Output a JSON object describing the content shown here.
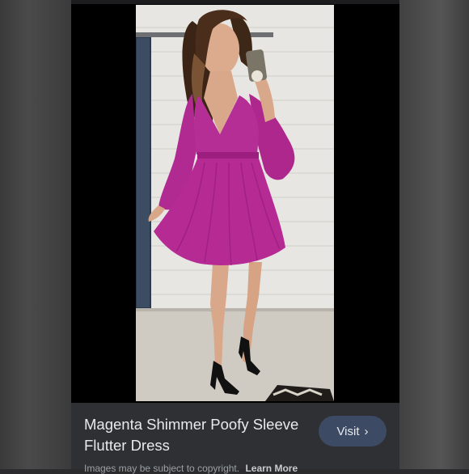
{
  "result": {
    "title": "Magenta Shimmer Poofy Sleeve Flutter Dress",
    "visit_label": "Visit",
    "copyright_notice": "Images may be subject to copyright.",
    "learn_more_label": "Learn More"
  },
  "icons": {
    "visit_chevron": "chevron-right-icon"
  },
  "colors": {
    "panel_bg": "#000000",
    "caption_bg": "#2f3033",
    "visit_button_bg": "#3c4a63",
    "dress": "#b0278f"
  }
}
